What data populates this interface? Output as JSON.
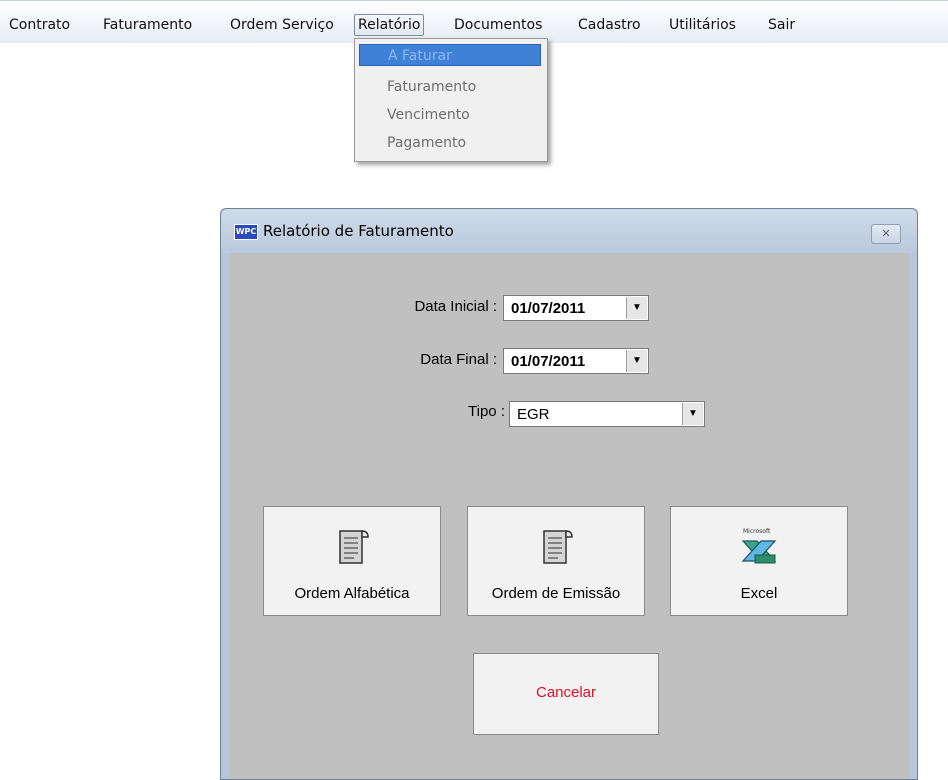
{
  "menubar": {
    "items": [
      "Contrato",
      "Faturamento",
      "Ordem Serviço",
      "Relatório",
      "Documentos",
      "Cadastro",
      "Utilitários",
      "Sair"
    ],
    "active": "Relatório"
  },
  "dropdown": {
    "items": [
      "A Faturar",
      "Faturamento",
      "Vencimento",
      "Pagamento"
    ],
    "selected": "A Faturar"
  },
  "dialog": {
    "icon_text": "WPC",
    "title": "Relatório de Faturamento",
    "close_icon": "close-icon",
    "data_inicial_label": "Data Inicial :",
    "data_inicial_value": "01/07/2011",
    "data_final_label": "Data Final :",
    "data_final_value": "01/07/2011",
    "tipo_label": "Tipo :",
    "tipo_value": "EGR",
    "buttons": {
      "ordem_alfabetica": "Ordem Alfabética",
      "ordem_emissao": "Ordem de Emissão",
      "excel": "Excel",
      "excel_logo_text": "Microsoft",
      "cancelar": "Cancelar"
    }
  },
  "colors": {
    "menu_highlight": "#3f81d6",
    "cancel_text": "#e0102a",
    "dialog_frame": "#b7c7da",
    "client_bg": "#c0c0c0"
  }
}
